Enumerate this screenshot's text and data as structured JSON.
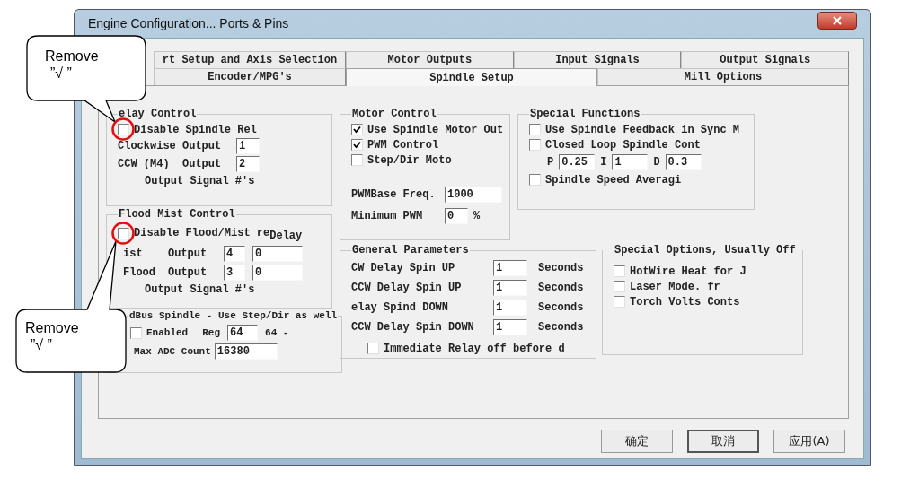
{
  "window": {
    "title": "Engine Configuration... Ports & Pins"
  },
  "tab_rows": [
    {
      "tabs": [
        {
          "label": "rt Setup and Axis Selection",
          "selected": false
        },
        {
          "label": "Motor Outputs",
          "selected": false
        },
        {
          "label": "Input Signals",
          "selected": false
        },
        {
          "label": "Output Signals",
          "selected": false
        }
      ]
    },
    {
      "tabs": [
        {
          "label": "Encoder/MPG's",
          "selected": false
        },
        {
          "label": "Spindle Setup",
          "selected": true
        },
        {
          "label": "Mill Options",
          "selected": false
        }
      ]
    }
  ],
  "relay_control": {
    "title": "elay Control",
    "disable": {
      "label": "Disable Spindle Rel",
      "checked": false
    },
    "rows": [
      {
        "label": "Clockwise",
        "output": "Output",
        "value": "1"
      },
      {
        "label": "CCW (M4)",
        "output": "Output",
        "value": "2"
      }
    ],
    "note": "Output Signal #'s"
  },
  "flood_mist_control": {
    "title": "Flood Mist Control",
    "disable": {
      "label": "Disable Flood/Mist re",
      "checked": false
    },
    "delay_label": "Delay",
    "rows": [
      {
        "label": "ist",
        "output": "Output",
        "value": "4",
        "delay": "0"
      },
      {
        "label": "Flood",
        "output": "Output",
        "value": "3",
        "delay": "0"
      }
    ],
    "note": "Output Signal #'s"
  },
  "modbus": {
    "title": "dBus Spindle - Use Step/Dir as well",
    "enabled": {
      "label": "Enabled",
      "checked": false
    },
    "reg_label": "Reg",
    "reg": "64",
    "reg_suffix": "64 -",
    "adc_label": "Max ADC Count",
    "adc": "16380"
  },
  "motor_control": {
    "title": "Motor Control",
    "options": [
      {
        "label": "Use Spindle Motor Out",
        "checked": true
      },
      {
        "label": "PWM Control",
        "checked": true
      },
      {
        "label": "Step/Dir Moto",
        "checked": false
      }
    ],
    "fields": [
      {
        "label": "PWMBase Freq.",
        "value": "1000"
      },
      {
        "label": "Minimum PWM",
        "value": "0",
        "unit": "%"
      }
    ]
  },
  "special_functions": {
    "title": "Special Functions",
    "options": [
      {
        "label": "Use Spindle Feedback in Sync M",
        "checked": false
      },
      {
        "label": "Closed Loop Spindle Cont",
        "checked": false
      }
    ],
    "pid": [
      {
        "label": "P",
        "value": "0.25"
      },
      {
        "label": "I",
        "value": "1"
      },
      {
        "label": "D",
        "value": "0.3"
      }
    ],
    "averaging": {
      "label": "Spindle Speed Averagi",
      "checked": false
    }
  },
  "general_parameters": {
    "title": "General Parameters",
    "rows": [
      {
        "label": "CW Delay Spin UP",
        "value": "1",
        "unit": "Seconds"
      },
      {
        "label": "CCW Delay Spin UP",
        "value": "1",
        "unit": "Seconds"
      },
      {
        "label": "elay Spind DOWN",
        "value": "1",
        "unit": "Seconds"
      },
      {
        "label": "CCW Delay Spin DOWN",
        "value": "1",
        "unit": "Seconds"
      }
    ],
    "immediate": {
      "label": "Immediate Relay off before d",
      "checked": false
    }
  },
  "special_options": {
    "title": "Special Options, Usually Off",
    "options": [
      {
        "label": "HotWire Heat for J",
        "checked": false
      },
      {
        "label": "Laser Mode. fr",
        "checked": false
      },
      {
        "label": "Torch Volts Conts",
        "checked": false
      }
    ]
  },
  "buttons": [
    {
      "label": "确定",
      "default": false
    },
    {
      "label": "取消",
      "default": true
    },
    {
      "label": "应用(A)",
      "default": false
    }
  ],
  "callouts": [
    {
      "lines": [
        "Remove",
        "”√ ”"
      ]
    },
    {
      "lines": [
        "Remove",
        "”√ ”"
      ]
    }
  ]
}
